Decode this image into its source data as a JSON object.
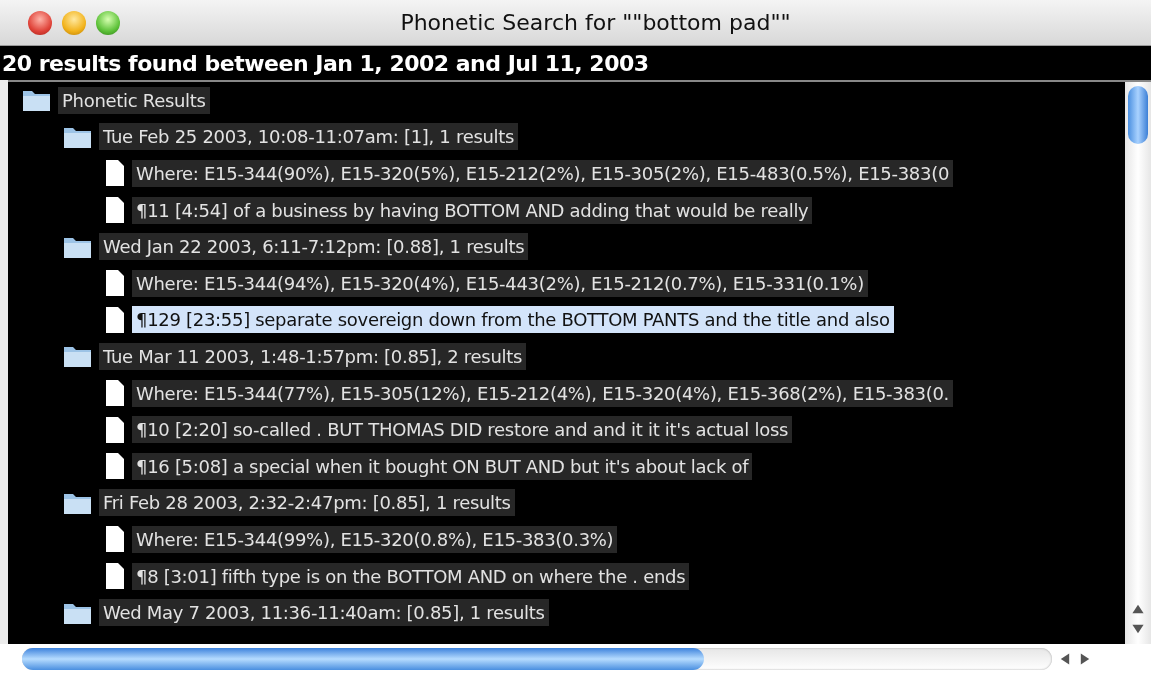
{
  "window": {
    "title": "Phonetic Search for \"\"bottom pad\"\""
  },
  "summary": "20 results found between Jan 1, 2002 and Jul 11, 2003",
  "tree": [
    {
      "kind": "folder",
      "label": "Phonetic Results",
      "selected": false,
      "children": [
        {
          "kind": "folder",
          "label": "Tue Feb 25 2003, 10:08-11:07am: [1], 1 results",
          "selected": false,
          "children": [
            {
              "kind": "document",
              "label": "Where: E15-344(90%), E15-320(5%), E15-212(2%), E15-305(2%), E15-483(0.5%), E15-383(0",
              "selected": false
            },
            {
              "kind": "document",
              "label": "¶11 [4:54] of a business by having BOTTOM AND adding that would be really",
              "selected": false
            }
          ]
        },
        {
          "kind": "folder",
          "label": "Wed Jan 22 2003, 6:11-7:12pm: [0.88], 1 results",
          "selected": false,
          "children": [
            {
              "kind": "document",
              "label": "Where: E15-344(94%), E15-320(4%), E15-443(2%), E15-212(0.7%), E15-331(0.1%)",
              "selected": false
            },
            {
              "kind": "document",
              "label": "¶129 [23:55] separate sovereign down from the BOTTOM PANTS and the title and also",
              "selected": true
            }
          ]
        },
        {
          "kind": "folder",
          "label": "Tue Mar 11 2003, 1:48-1:57pm: [0.85], 2 results",
          "selected": false,
          "children": [
            {
              "kind": "document",
              "label": "Where: E15-344(77%), E15-305(12%), E15-212(4%), E15-320(4%), E15-368(2%), E15-383(0.",
              "selected": false
            },
            {
              "kind": "document",
              "label": "¶10 [2:20] so-called . BUT THOMAS DID restore and and it it it's actual loss",
              "selected": false
            },
            {
              "kind": "document",
              "label": "¶16 [5:08] a special when it bought ON BUT AND but it's about lack of",
              "selected": false
            }
          ]
        },
        {
          "kind": "folder",
          "label": "Fri Feb 28 2003, 2:32-2:47pm: [0.85], 1 results",
          "selected": false,
          "children": [
            {
              "kind": "document",
              "label": "Where: E15-344(99%), E15-320(0.8%), E15-383(0.3%)",
              "selected": false
            },
            {
              "kind": "document",
              "label": "¶8 [3:01] fifth type is on the BOTTOM AND on where the . ends",
              "selected": false
            }
          ]
        },
        {
          "kind": "folder",
          "label": "Wed May 7 2003, 11:36-11:40am: [0.85], 1 results",
          "selected": false
        }
      ]
    }
  ]
}
